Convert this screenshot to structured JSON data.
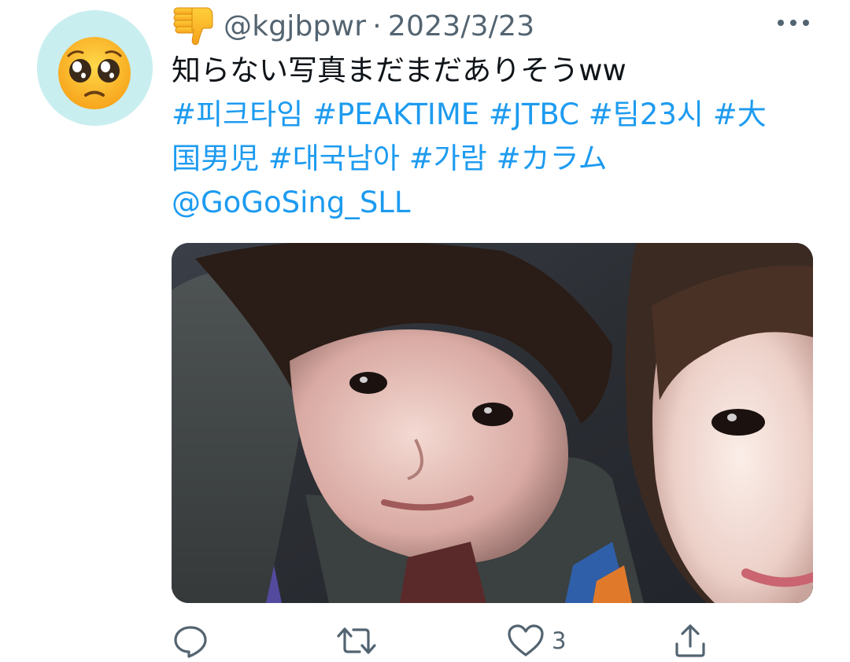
{
  "tweet": {
    "avatar_emoji": "pleading-face",
    "prefix_emoji": "thumbs-down",
    "handle": "@kgjbpwr",
    "separator": "·",
    "date": "2023/3/23",
    "text_line_1": "知らない写真まだまだありそうww",
    "hashtags": {
      "h1": "#피크타임",
      "h2": "#PEAKTIME",
      "h3": "#JTBC",
      "h4": "#팀23시",
      "h5_part1": "#大",
      "h5_part2": "国男児",
      "h6": "#대국남아",
      "h7": "#가람",
      "h8": "#カラム"
    },
    "mention": "@GoGoSing_SLL",
    "media_alt": "selfie photo of two people",
    "actions": {
      "reply_icon": "reply-icon",
      "retweet_icon": "retweet-icon",
      "like_icon": "heart-icon",
      "like_count": "3",
      "share_icon": "share-icon"
    },
    "colors": {
      "link": "#1d9bf0",
      "muted": "#536471",
      "text": "#0f1419",
      "avatar_bg": "#c9eeef"
    }
  }
}
